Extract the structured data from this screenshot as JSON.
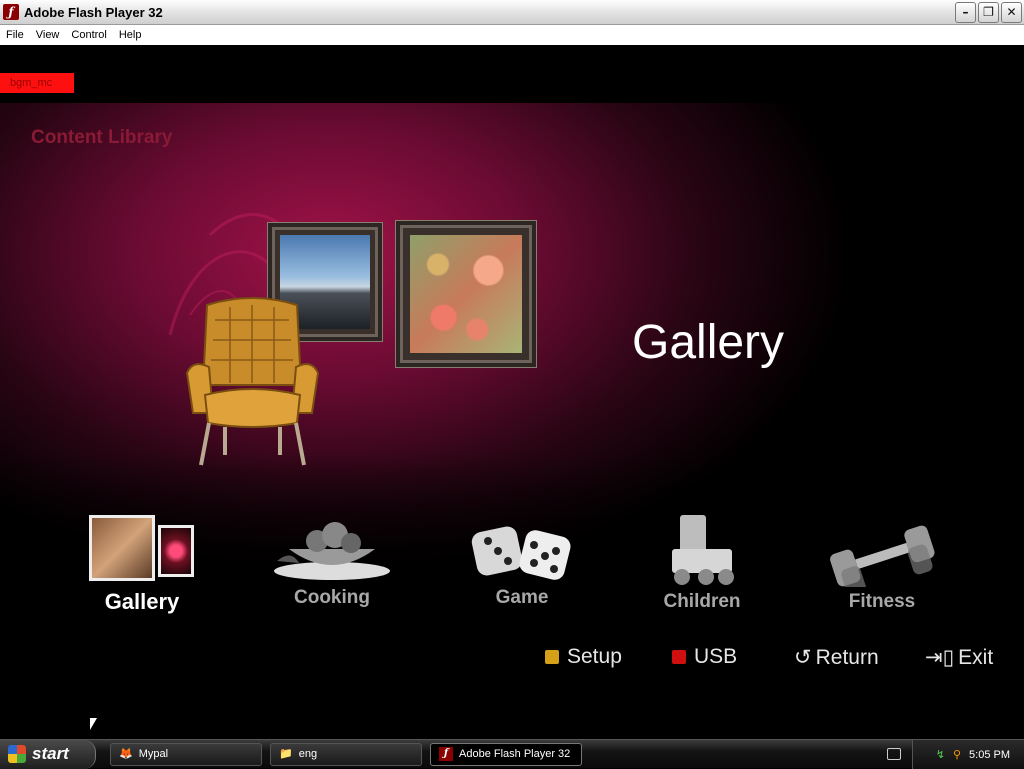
{
  "window": {
    "title": "Adobe Flash Player 32"
  },
  "menubar": {
    "items": [
      "File",
      "View",
      "Control",
      "Help"
    ]
  },
  "flash": {
    "debug_label": "bgm_mc",
    "library_title": "Content Library",
    "selected_title": "Gallery",
    "menu": [
      {
        "label": "Gallery",
        "icon": "gallery-frames-icon"
      },
      {
        "label": "Cooking",
        "icon": "cooking-bowl-icon"
      },
      {
        "label": "Game",
        "icon": "dice-icon"
      },
      {
        "label": "Children",
        "icon": "toy-train-icon"
      },
      {
        "label": "Fitness",
        "icon": "dumbbell-icon"
      }
    ],
    "bottom_buttons": [
      {
        "label": "Setup",
        "color": "#d4a017"
      },
      {
        "label": "USB",
        "color": "#d01010"
      },
      {
        "label": "Return",
        "icon": "return-icon"
      },
      {
        "label": "Exit",
        "icon": "exit-icon"
      }
    ]
  },
  "taskbar": {
    "start_label": "start",
    "tasks": [
      "Mypal",
      "eng",
      "Adobe Flash Player 32"
    ],
    "clock": "5:05 PM"
  }
}
